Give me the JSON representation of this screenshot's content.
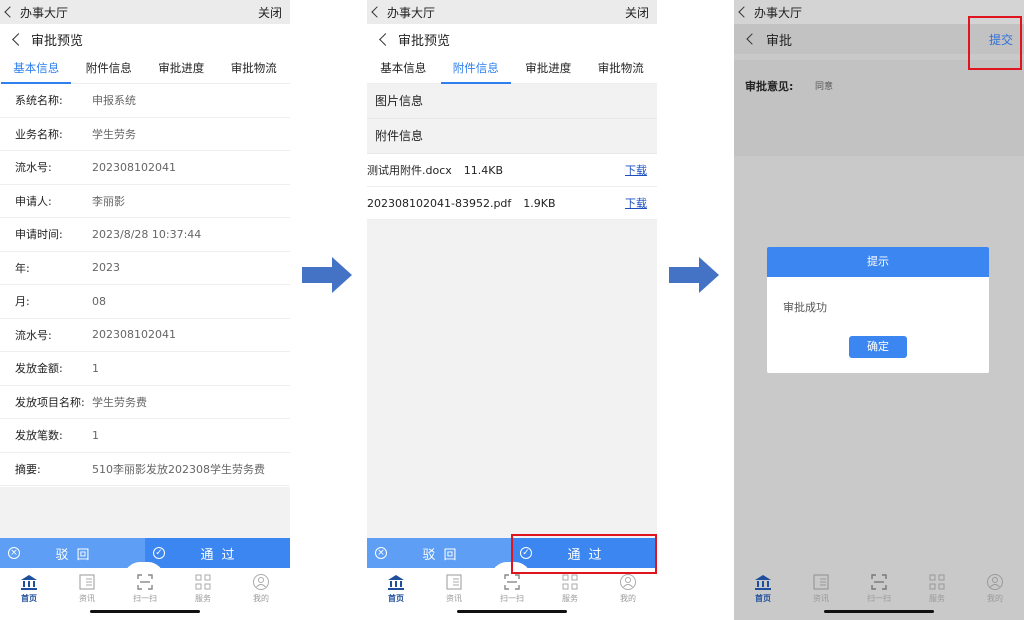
{
  "colors": {
    "accent": "#3b86f0",
    "highlight_box": "#e0141e"
  },
  "screen1": {
    "status_back": "办事大厅",
    "status_close": "关闭",
    "nav_title": "审批预览",
    "tabs": [
      "基本信息",
      "附件信息",
      "审批进度",
      "审批物流"
    ],
    "fields": [
      {
        "label": "系统名称:",
        "value": "申报系统"
      },
      {
        "label": "业务名称:",
        "value": "学生劳务"
      },
      {
        "label": "流水号:",
        "value": "202308102041"
      },
      {
        "label": "申请人:",
        "value": "李丽影"
      },
      {
        "label": "申请时间:",
        "value": "2023/8/28 10:37:44"
      },
      {
        "label": "年:",
        "value": "2023"
      },
      {
        "label": "月:",
        "value": "08"
      },
      {
        "label": "流水号:",
        "value": "202308102041"
      },
      {
        "label": "发放金额:",
        "value": "1"
      },
      {
        "label": "发放项目名称:",
        "value": "学生劳务费"
      },
      {
        "label": "发放笔数:",
        "value": "1"
      },
      {
        "label": "摘要:",
        "value": "510李丽影发放202308学生劳务费"
      }
    ],
    "reject_label": "驳回",
    "pass_label": "通过"
  },
  "screen2": {
    "status_back": "办事大厅",
    "status_close": "关闭",
    "nav_title": "审批预览",
    "tabs": [
      "基本信息",
      "附件信息",
      "审批进度",
      "审批物流"
    ],
    "section_images": "图片信息",
    "section_attachments": "附件信息",
    "files": [
      {
        "name": "测试用附件.docx",
        "size": "11.4KB",
        "action": "下载"
      },
      {
        "name": "202308102041-83952.pdf",
        "size": "1.9KB",
        "action": "下载"
      }
    ],
    "reject_label": "驳回",
    "pass_label": "通过"
  },
  "screen3": {
    "status_back": "办事大厅",
    "nav_title": "审批",
    "submit_label": "提交",
    "opinion_label": "审批意见:",
    "opinion_value": "同意",
    "dialog": {
      "title": "提示",
      "message": "审批成功",
      "ok_label": "确定"
    }
  },
  "tabbar": [
    "首页",
    "资讯",
    "扫一扫",
    "服务",
    "我的"
  ],
  "icons": [
    "bank-icon",
    "news-icon",
    "scan-icon",
    "grid-icon",
    "user-icon",
    "close-circle-icon",
    "check-circle-icon",
    "right-arrow-icon"
  ]
}
